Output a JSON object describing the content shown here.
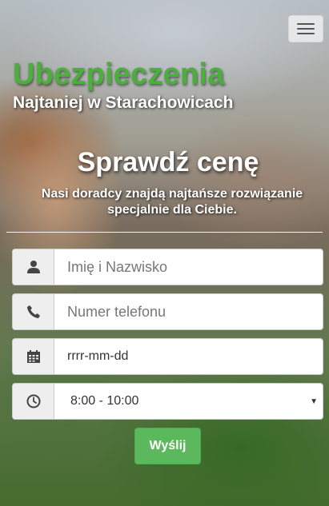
{
  "header": {
    "title": "Ubezpieczenia",
    "subtitle": "Najtaniej w Starachowicach"
  },
  "hero": {
    "headline": "Sprawdź cenę",
    "subline": "Nasi doradcy znajdą najtańsze rozwiązanie specjalnie dla Ciebie."
  },
  "form": {
    "name_placeholder": "Imię i Nazwisko",
    "phone_placeholder": "Numer telefonu",
    "date_value": "rrrr-mm-dd",
    "time_selected": "8:00 - 10:00",
    "submit_label": "Wyślij"
  },
  "colors": {
    "brand_green": "#4cae3c",
    "button_green": "#5cb85c"
  },
  "icons": {
    "menu": "hamburger-icon",
    "name": "user-icon",
    "phone": "phone-icon",
    "date": "calendar-icon",
    "time": "clock-icon",
    "select": "caret-down-icon"
  }
}
